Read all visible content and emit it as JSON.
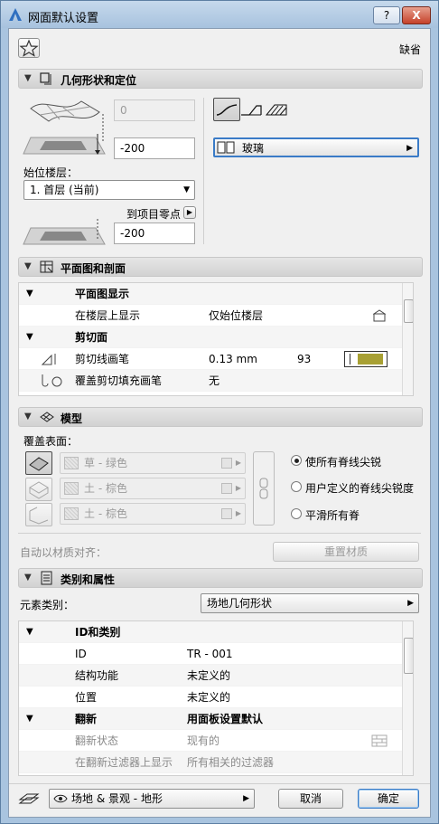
{
  "window": {
    "title": "网面默认设置",
    "help_label": "?",
    "close_label": "X",
    "default_label": "缺省"
  },
  "geometry": {
    "header": "几何形状和定位",
    "top_offset": "0",
    "height_value": "-200",
    "home_story_label": "始位楼层：",
    "home_story_value": "1. 首层 (当前)",
    "to_project_zero_label": "到项目零点",
    "bottom_offset": "-200",
    "material_dropdown": "玻璃"
  },
  "plan_section": {
    "header": "平面图和剖面",
    "rows": [
      {
        "c1": "平面图显示",
        "c2": "",
        "c3": "",
        "group": true
      },
      {
        "c1": "在楼层上显示",
        "c2": "仅始位楼层",
        "c3": "",
        "group": false
      },
      {
        "c1": "剪切面",
        "c2": "",
        "c3": "",
        "group": true
      },
      {
        "c1": "剪切线画笔",
        "c2": "0.13 mm",
        "c3": "93",
        "group": false
      },
      {
        "c1": "覆盖剪切填充画笔",
        "c2": "无",
        "c3": "",
        "group": false
      }
    ]
  },
  "model": {
    "header": "模型",
    "override_label": "覆盖表面：",
    "surfaces": [
      "草 - 绿色",
      "土 - 棕色",
      "土 - 棕色"
    ],
    "radios": [
      "使所有脊线尖锐",
      "用户定义的脊线尖锐度",
      "平滑所有脊"
    ],
    "selected_radio": 0,
    "align_label": "自动以材质对齐：",
    "reset_button": "重置材质"
  },
  "classification": {
    "header": "类别和属性",
    "element_class_label": "元素类别：",
    "element_class_value": "场地几何形状",
    "rows": [
      {
        "c1": "ID和类别",
        "c2": "",
        "group": true
      },
      {
        "c1": "ID",
        "c2": "TR - 001",
        "group": false
      },
      {
        "c1": "结构功能",
        "c2": "未定义的",
        "group": false
      },
      {
        "c1": "位置",
        "c2": "未定义的",
        "group": false
      },
      {
        "c1": "翻新",
        "c2": "用面板设置默认",
        "group": true
      },
      {
        "c1": "翻新状态",
        "c2": "现有的",
        "group": false
      },
      {
        "c1": "在翻新过滤器上显示",
        "c2": "所有相关的过滤器",
        "group": false
      }
    ]
  },
  "footer": {
    "layer_value": "场地 & 景观 - 地形",
    "cancel_button": "取消",
    "ok_button": "确定"
  },
  "colors": {
    "pen_swatch": "#a8a033"
  }
}
